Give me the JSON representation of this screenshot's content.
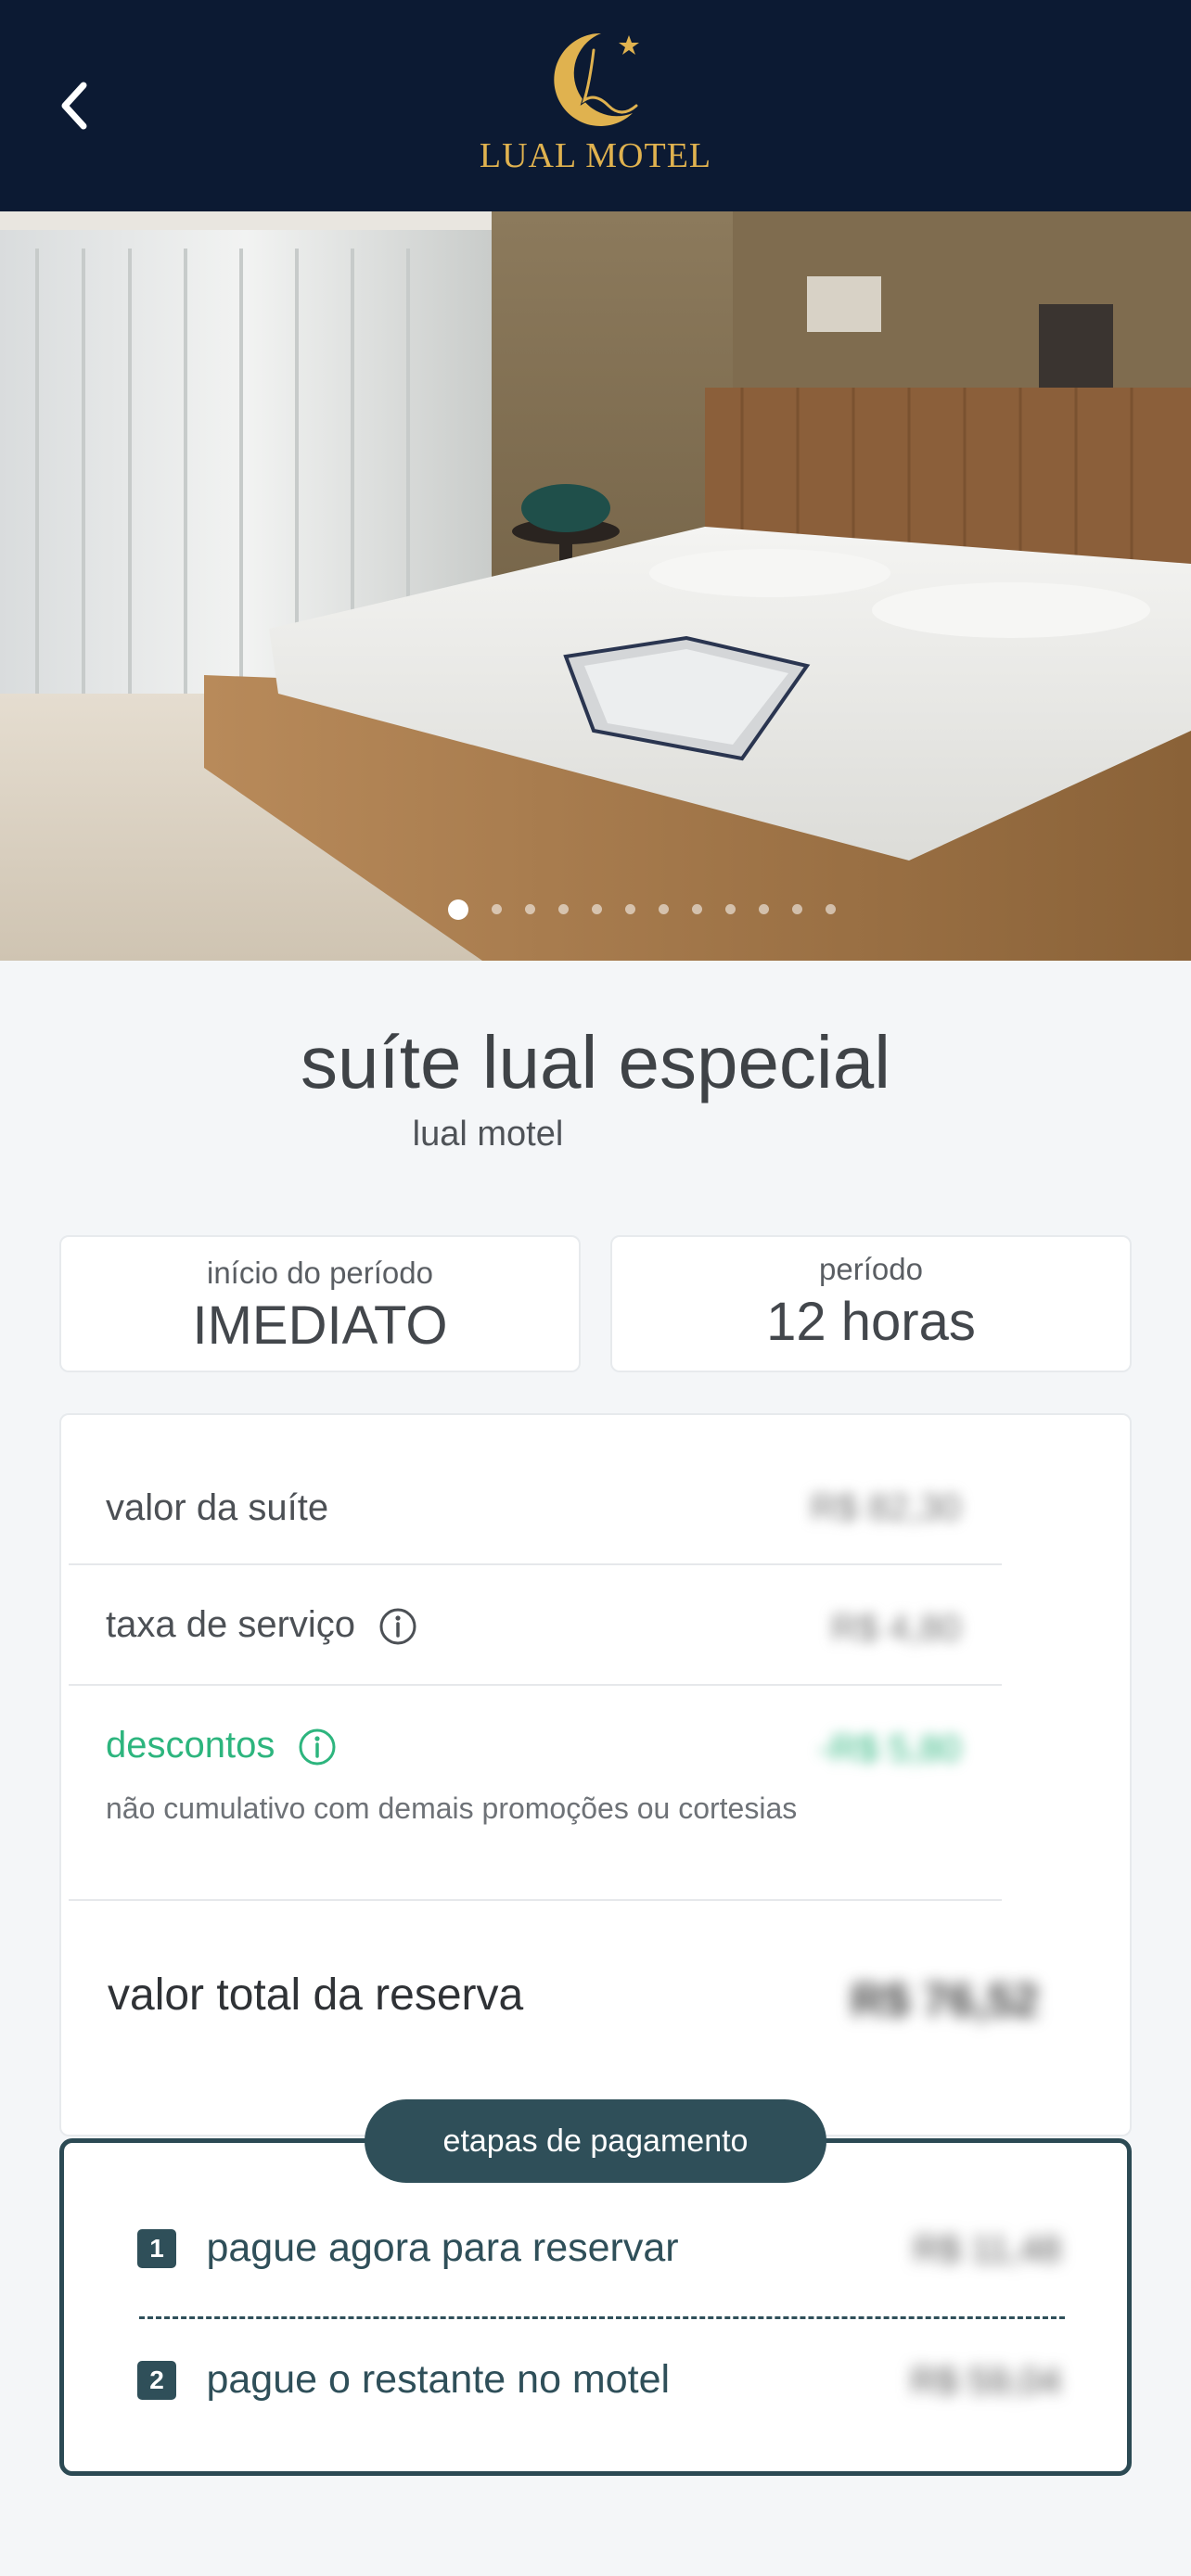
{
  "header": {
    "back_icon": "chevron-left-icon",
    "logo_text": "LUAL MOTEL",
    "logo_color": "#e0b24f",
    "background": "#0c1a33"
  },
  "gallery": {
    "image_description_icon": "suite-photo",
    "dot_count": 12,
    "active_index": 0
  },
  "suite": {
    "title": "suíte lual especial",
    "motel": "lual motel"
  },
  "period": {
    "start_label": "início do período",
    "start_value": "IMEDIATO",
    "duration_label": "período",
    "duration_value": "12 horas"
  },
  "pricing": {
    "suite_label": "valor da suíte",
    "suite_value": "R$ 82,30",
    "fee_label": "taxa de serviço",
    "fee_value": "R$ 4,80",
    "discount_label": "descontos",
    "discount_value": "-R$ 5,80",
    "discount_note": "não cumulativo com demais promoções ou cortesias",
    "total_label": "valor total da reserva",
    "total_value": "R$ 76,52",
    "accent_green": "#2db57e"
  },
  "payment_steps": {
    "title": "etapas de pagamento",
    "step1_num": "1",
    "step1_label": "pague agora para reservar",
    "step1_value": "R$ 11,48",
    "step2_num": "2",
    "step2_label": "pague o restante no motel",
    "step2_value": "R$ 59,04",
    "accent": "#2f4f59"
  }
}
